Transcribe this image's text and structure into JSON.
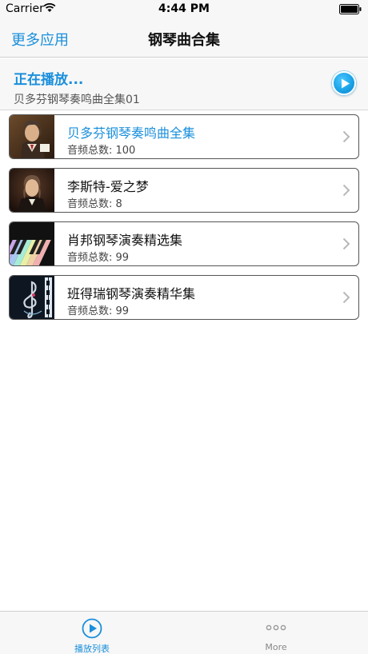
{
  "status_bar": {
    "carrier": "Carrier",
    "time": "4:44 PM"
  },
  "nav": {
    "left_button": "更多应用",
    "title": "钢琴曲合集"
  },
  "now_playing": {
    "title": "正在播放...",
    "track": "贝多芬钢琴奏鸣曲全集01",
    "play_icon": "play-icon"
  },
  "albums": [
    {
      "title": "贝多芬钢琴奏鸣曲全集",
      "count": "音频总数: 100",
      "thumb": "beethoven-portrait",
      "selected": true
    },
    {
      "title": "李斯特-爱之梦",
      "count": "音频总数: 8",
      "thumb": "liszt-portrait",
      "selected": false
    },
    {
      "title": "肖邦钢琴演奏精选集",
      "count": "音频总数: 99",
      "thumb": "piano-keys-image",
      "selected": false
    },
    {
      "title": "班得瑞钢琴演奏精华集",
      "count": "音频总数: 99",
      "thumb": "treble-clef-image",
      "selected": false
    }
  ],
  "tab_bar": {
    "tabs": [
      {
        "label": "播放列表",
        "icon": "play-circle-icon",
        "active": true
      },
      {
        "label": "More",
        "icon": "more-dots-icon",
        "active": false
      }
    ]
  },
  "colors": {
    "accent": "#1a8fdb",
    "bar_background": "#f7f7f7",
    "border": "#555555"
  }
}
